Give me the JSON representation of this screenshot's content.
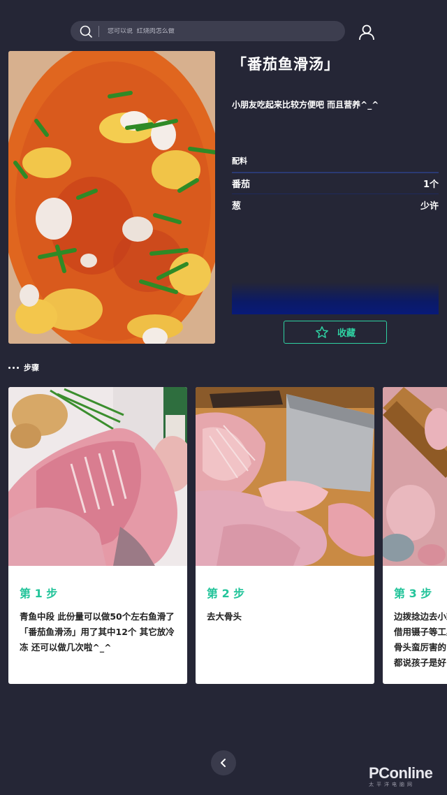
{
  "search": {
    "placeholder": "您可以说  红烧肉怎么做"
  },
  "recipe": {
    "title": "「番茄鱼滑汤」",
    "description": "小朋友吃起来比较方便吧 而且营养^_^",
    "ingredients_label": "配料",
    "ingredients": [
      {
        "name": "番茄",
        "amount": "1个"
      },
      {
        "name": "葱",
        "amount": "少许"
      }
    ],
    "favorite_label": "收藏"
  },
  "steps_label": "步骤",
  "steps": [
    {
      "title": "第 1 步",
      "text": "青鱼中段 此份量可以做50个左右鱼滑了 「番茄鱼滑汤」用了其中12个 其它放冷冻 还可以做几次啦^_^"
    },
    {
      "title": "第 2 步",
      "text": "去大骨头"
    },
    {
      "title": "第 3 步",
      "text": "边拨捻边去小刺\n借用镊子等工具\n骨头蛮厉害的\n都说孩子是好"
    }
  ],
  "watermark": {
    "main": "PConline",
    "sub": "太平洋电脑网"
  },
  "colors": {
    "background": "#252636",
    "accent": "#2fd1a2",
    "card_title": "#23c49a"
  }
}
